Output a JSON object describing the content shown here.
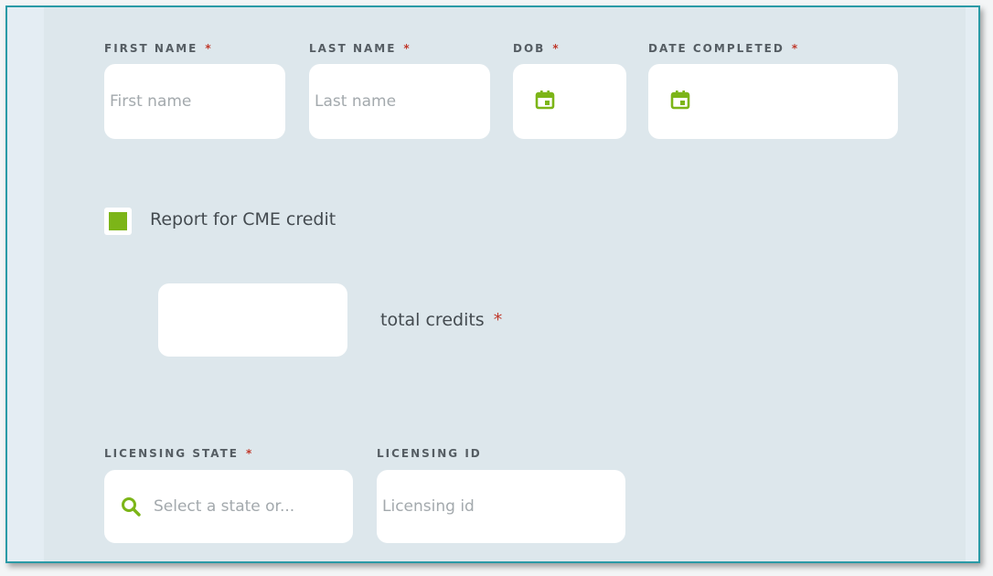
{
  "form": {
    "first_name": {
      "label": "FIRST NAME",
      "required": "*",
      "placeholder": "First name"
    },
    "last_name": {
      "label": "LAST NAME",
      "required": "*",
      "placeholder": "Last name"
    },
    "dob": {
      "label": "DOB",
      "required": "*",
      "icon": "calendar-icon"
    },
    "date_completed": {
      "label": "DATE COMPLETED",
      "required": "*",
      "icon": "calendar-icon"
    },
    "cme_checkbox": {
      "label": "Report for CME credit",
      "checked": true
    },
    "total_credits": {
      "label": "total credits",
      "required": "*",
      "value": ""
    },
    "licensing_state": {
      "label": "LICENSING STATE",
      "required": "*",
      "placeholder": "Select a state or...",
      "icon": "search-icon"
    },
    "licensing_id": {
      "label": "LICENSING ID",
      "placeholder": "Licensing id"
    }
  },
  "colors": {
    "accent_green": "#7cb518",
    "required_red": "#c0392b",
    "frame_border": "#2a9aa6",
    "panel_bg": "#dde7ec"
  }
}
